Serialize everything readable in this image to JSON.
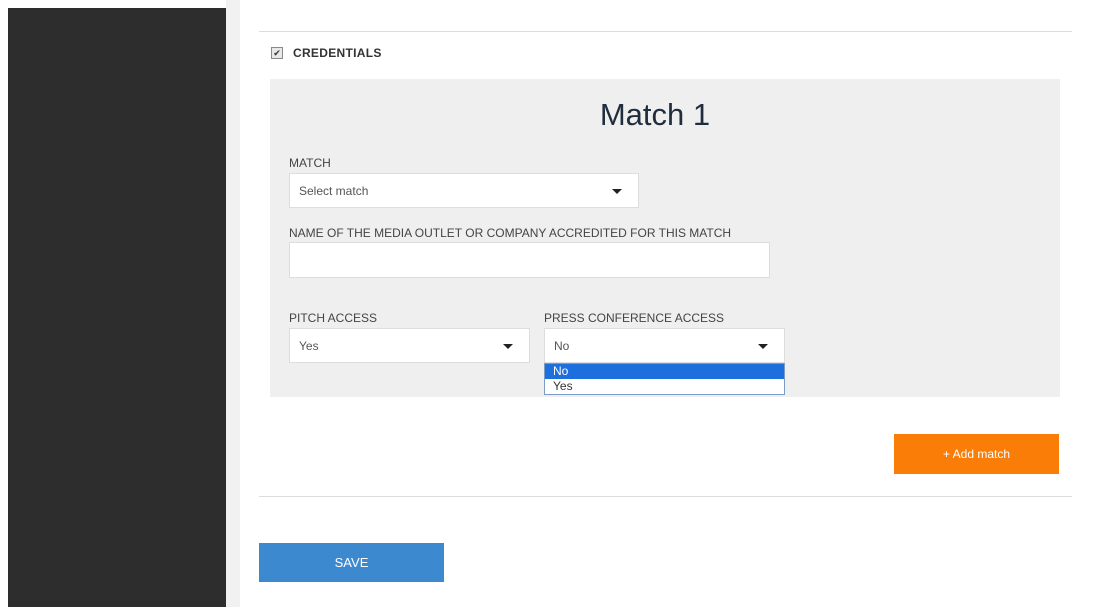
{
  "credentials": {
    "label": "CREDENTIALS",
    "checked": true,
    "check_glyph": "✔"
  },
  "match_panel": {
    "title": "Match 1",
    "match_field": {
      "label": "MATCH",
      "value": "Select match"
    },
    "outlet_field": {
      "label": "NAME OF THE MEDIA OUTLET OR COMPANY ACCREDITED FOR THIS MATCH",
      "value": ""
    },
    "pitch_access": {
      "label": "PITCH ACCESS",
      "value": "Yes"
    },
    "press_conference_access": {
      "label": "PRESS CONFERENCE ACCESS",
      "value": "No",
      "options": [
        "No",
        "Yes"
      ],
      "highlighted_option": "No"
    }
  },
  "buttons": {
    "add_match": "+ Add match",
    "save": "SAVE"
  },
  "colors": {
    "sidebar": "#2d2d2d",
    "panel_background": "#efefef",
    "add_match_button": "#fa7d08",
    "save_button": "#3c89d0",
    "dropdown_highlight": "#1e6fde"
  },
  "icons": {
    "select_caret": "caret-down-icon",
    "checkbox": "checkbox-checked-icon"
  }
}
